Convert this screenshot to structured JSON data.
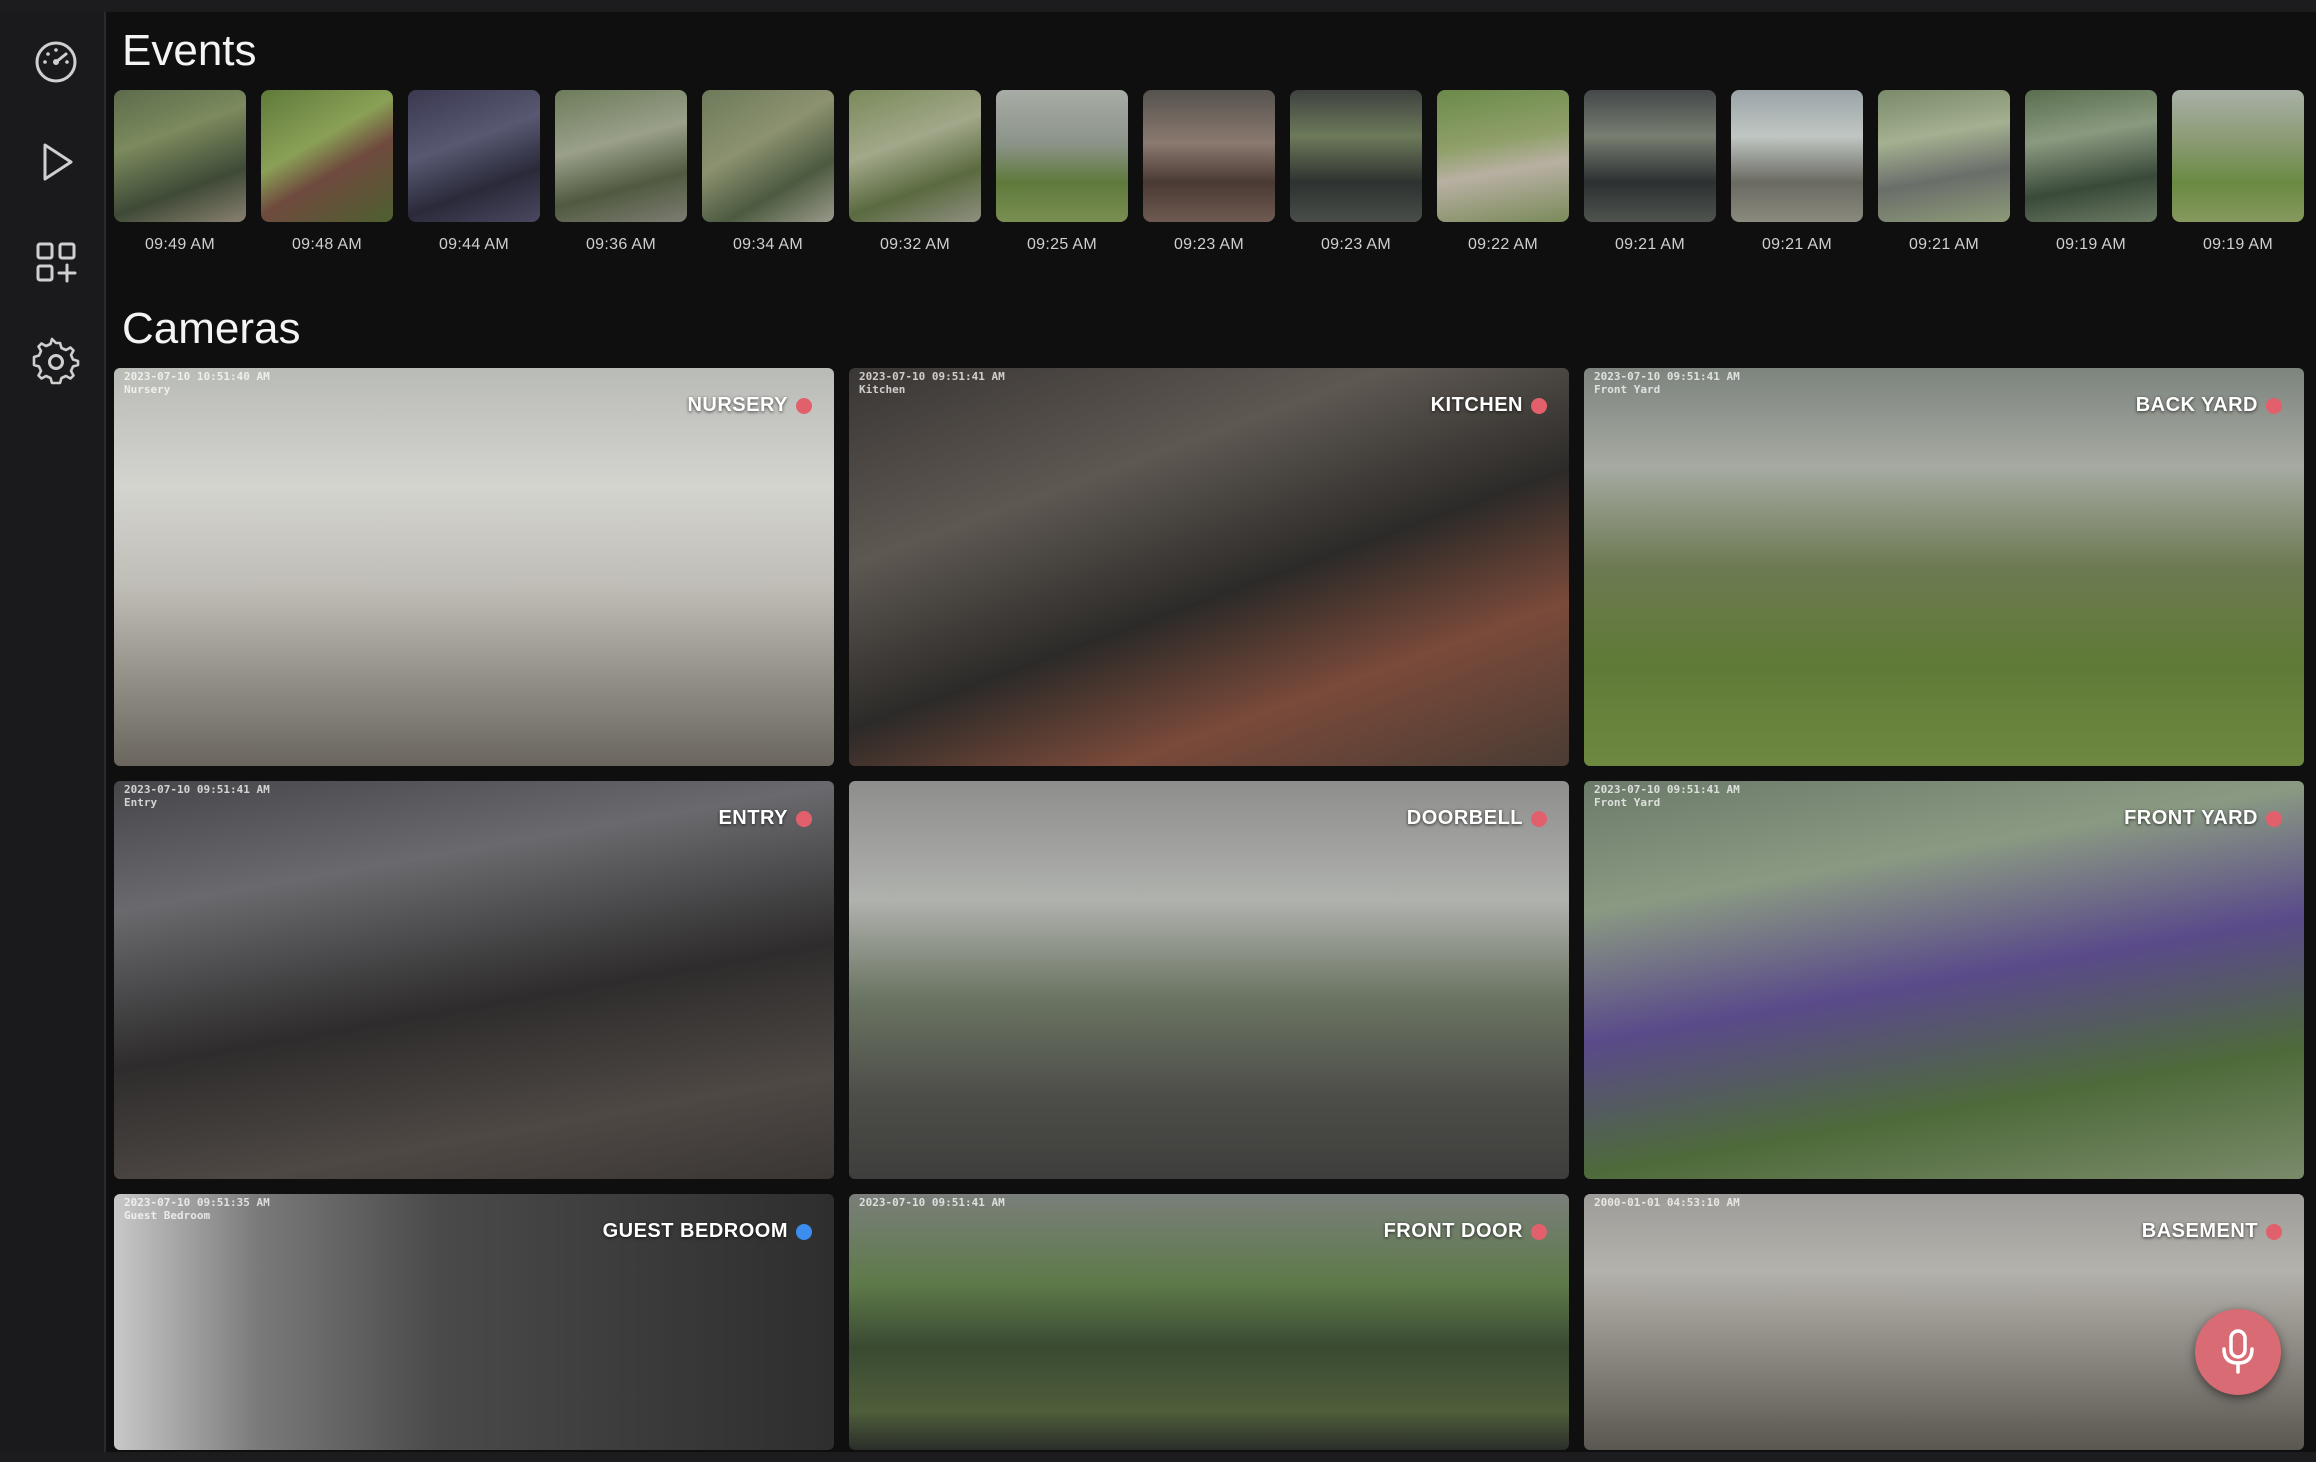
{
  "sections": {
    "events_title": "Events",
    "cameras_title": "Cameras"
  },
  "sidebar": {
    "items": [
      {
        "icon": "dashboard-gauge-icon"
      },
      {
        "icon": "play-icon"
      },
      {
        "icon": "add-grid-icon"
      },
      {
        "icon": "gear-icon"
      }
    ]
  },
  "events": [
    {
      "time": "09:49 AM"
    },
    {
      "time": "09:48 AM"
    },
    {
      "time": "09:44 AM"
    },
    {
      "time": "09:36 AM"
    },
    {
      "time": "09:34 AM"
    },
    {
      "time": "09:32 AM"
    },
    {
      "time": "09:25 AM"
    },
    {
      "time": "09:23 AM"
    },
    {
      "time": "09:23 AM"
    },
    {
      "time": "09:22 AM"
    },
    {
      "time": "09:21 AM"
    },
    {
      "time": "09:21 AM"
    },
    {
      "time": "09:21 AM"
    },
    {
      "time": "09:19 AM"
    },
    {
      "time": "09:19 AM"
    }
  ],
  "cameras": [
    {
      "label": "NURSERY",
      "status_color": "#e2606b",
      "stamp": "2023-07-10 10:51:40 AM\nNursery"
    },
    {
      "label": "KITCHEN",
      "status_color": "#e2606b",
      "stamp": "2023-07-10 09:51:41 AM\nKitchen"
    },
    {
      "label": "BACK YARD",
      "status_color": "#e2606b",
      "stamp": "2023-07-10 09:51:41 AM\nFront Yard"
    },
    {
      "label": "ENTRY",
      "status_color": "#e2606b",
      "stamp": "2023-07-10 09:51:41 AM\nEntry"
    },
    {
      "label": "DOORBELL",
      "status_color": "#e2606b",
      "stamp": ""
    },
    {
      "label": "FRONT YARD",
      "status_color": "#e2606b",
      "stamp": "2023-07-10 09:51:41 AM\nFront Yard"
    },
    {
      "label": "GUEST BEDROOM",
      "status_color": "#3b8df0",
      "stamp": "2023-07-10 09:51:35 AM\nGuest Bedroom"
    },
    {
      "label": "FRONT DOOR",
      "status_color": "#e2606b",
      "stamp": "2023-07-10 09:51:41 AM"
    },
    {
      "label": "BASEMENT",
      "status_color": "#e2606b",
      "stamp": "2000-01-01 04:53:10 AM"
    }
  ],
  "mic": {
    "icon": "microphone-icon",
    "color": "#d96b75"
  }
}
